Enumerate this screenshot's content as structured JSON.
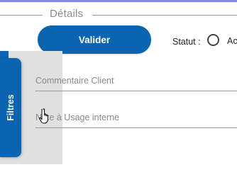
{
  "section": {
    "title": "Détails"
  },
  "actions": {
    "validate_label": "Valider"
  },
  "status": {
    "label": "Statut :",
    "option_label": "Ac"
  },
  "filters": {
    "tab_label": "Filtres"
  },
  "fields": {
    "client_comment": {
      "placeholder": "Commentaire Client"
    },
    "internal_note": {
      "placeholder": "Note à Usage interne"
    }
  },
  "colors": {
    "accent": "#0a64b2",
    "top_bar": "#8a86e6",
    "panel_background": "#e0e0e0"
  },
  "icons": {
    "cursor": "hand-pointer-icon"
  }
}
